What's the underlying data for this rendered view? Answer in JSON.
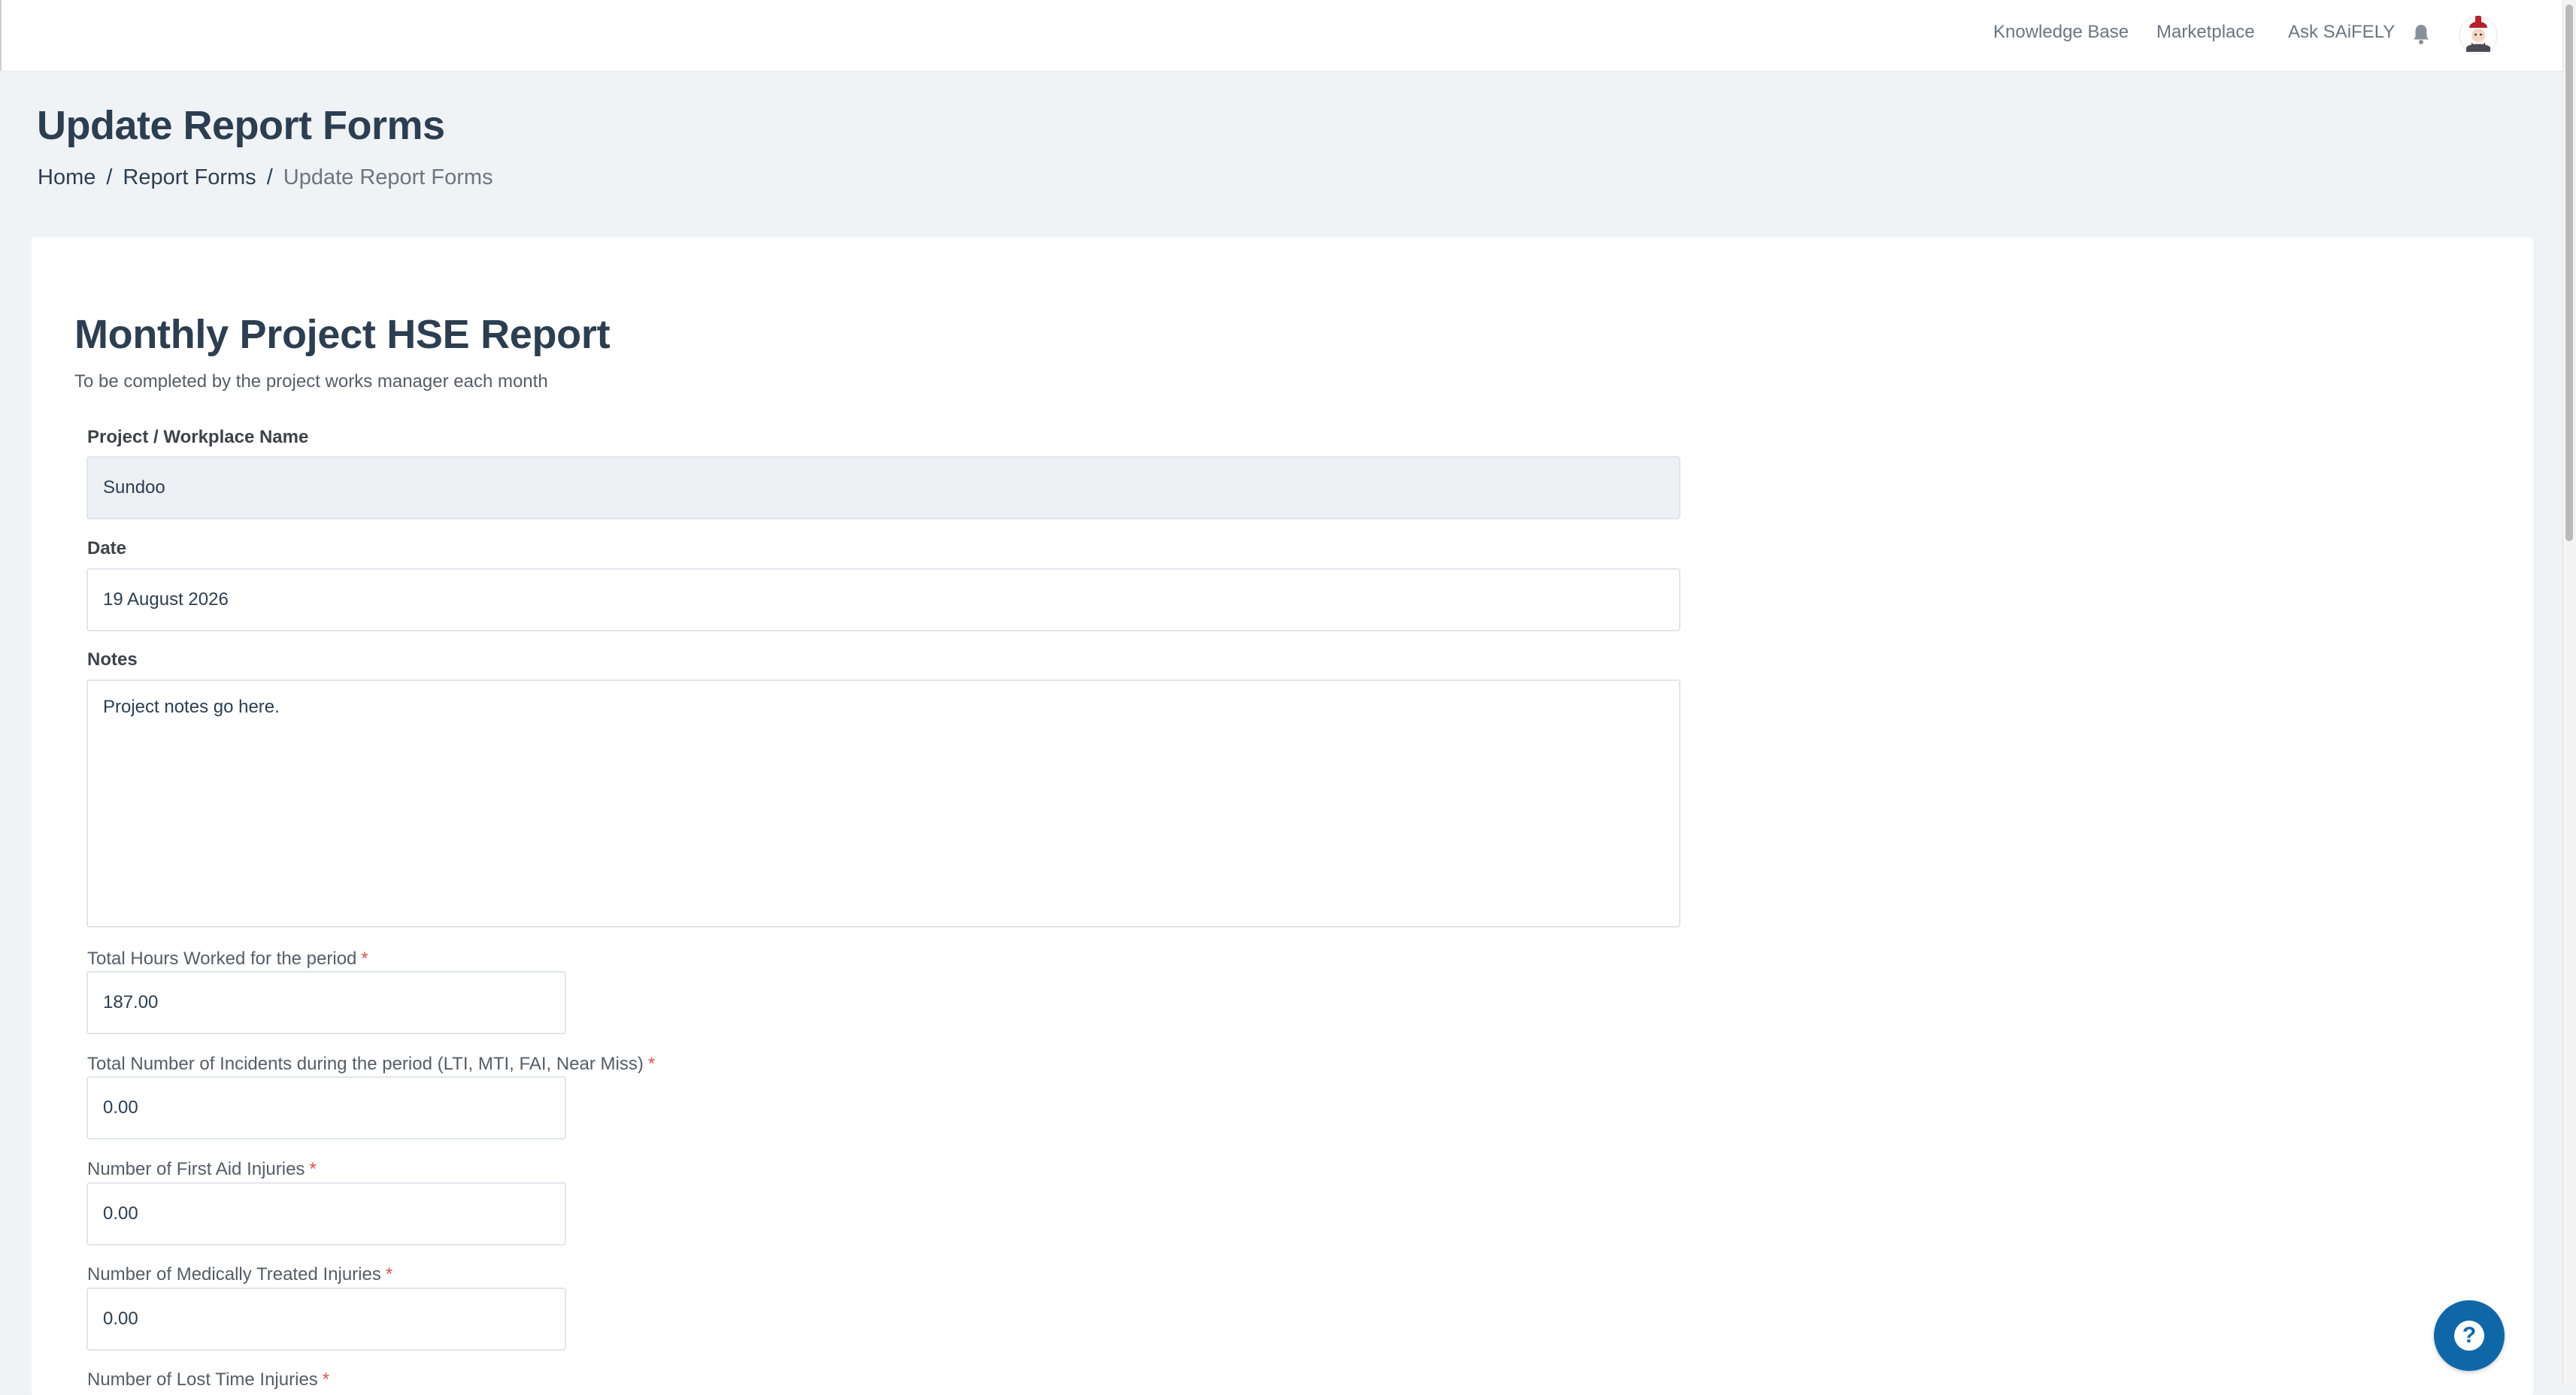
{
  "nav": {
    "knowledge_base": "Knowledge Base",
    "marketplace": "Marketplace",
    "ask_saifely": "Ask SAiFELY"
  },
  "page": {
    "title": "Update Report Forms",
    "breadcrumb": [
      "Home",
      "Report Forms",
      "Update Report Forms"
    ],
    "breadcrumb_separator": "/"
  },
  "form": {
    "title": "Monthly Project HSE Report",
    "subtitle": "To be completed by the project works manager each month",
    "required_marker": "*",
    "project_name": {
      "label": "Project / Workplace Name",
      "value": "Sundoo"
    },
    "date": {
      "label": "Date",
      "value": "19 August 2026"
    },
    "notes": {
      "label": "Notes",
      "value": "Project notes go here."
    },
    "total_hours": {
      "label": "Total Hours Worked for the period",
      "value": "187.00"
    },
    "total_incidents": {
      "label": "Total Number of Incidents during the period (LTI, MTI, FAI, Near Miss)",
      "value": "0.00"
    },
    "first_aid": {
      "label": "Number of First Aid Injuries",
      "value": "0.00"
    },
    "medically_treated": {
      "label": "Number of Medically Treated Injuries",
      "value": "0.00"
    },
    "lost_time": {
      "label": "Number of Lost Time Injuries"
    }
  },
  "help_button": {
    "symbol": "?"
  },
  "icons": {
    "bell": "bell-icon",
    "help": "question-icon",
    "avatar": "user-avatar"
  },
  "colors": {
    "page_bg": "#f0f3f6",
    "heading": "#2c3e50",
    "required": "#d9534f",
    "help_button": "#0f67a8",
    "readonly_field": "#eef1f4"
  }
}
